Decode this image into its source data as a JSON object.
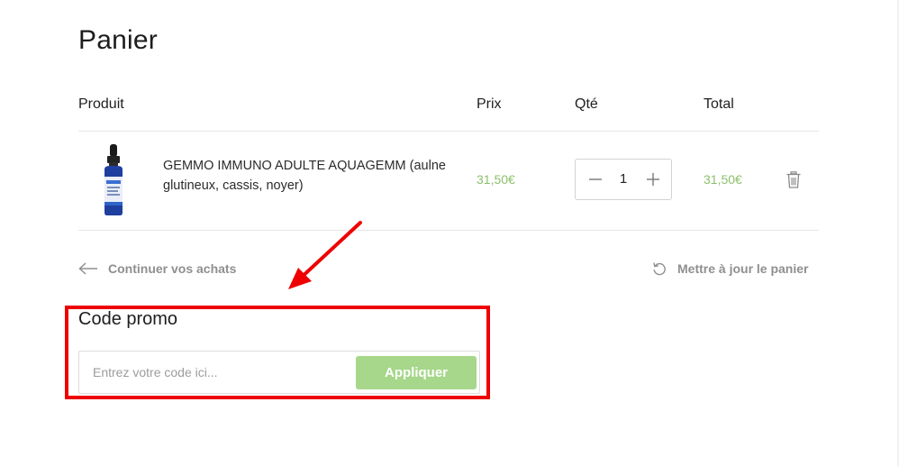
{
  "page": {
    "title": "Panier"
  },
  "table": {
    "headers": {
      "product": "Produit",
      "price": "Prix",
      "qty": "Qté",
      "total": "Total"
    },
    "items": [
      {
        "name": "GEMMO IMMUNO ADULTE AQUAGEMM (aulne glutineux, cassis, noyer)",
        "price": "31,50€",
        "quantity": "1",
        "total": "31,50€",
        "image_icon": "dropper-bottle"
      }
    ]
  },
  "actions": {
    "continue_label": "Continuer vos achats",
    "update_label": "Mettre à jour le panier"
  },
  "promo": {
    "title": "Code promo",
    "placeholder": "Entrez votre code ici...",
    "value": "",
    "apply_label": "Appliquer"
  },
  "colors": {
    "accent_green": "#a6d78a",
    "price_green": "#8cc06b",
    "highlight_red": "#ee0000"
  }
}
